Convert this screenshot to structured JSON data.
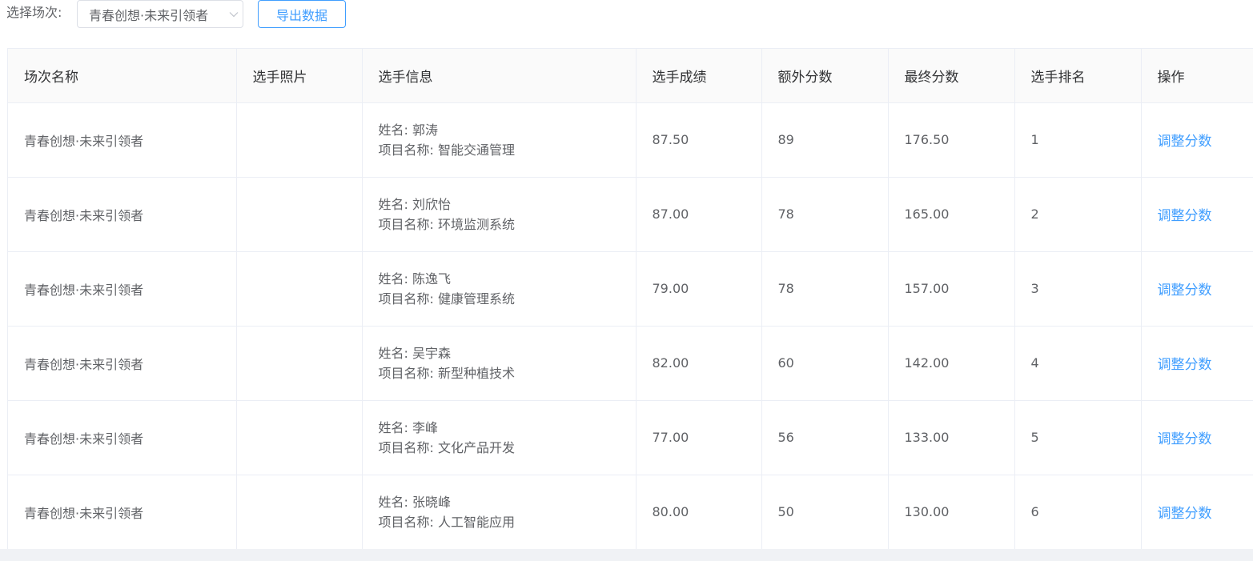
{
  "filter": {
    "label": "选择场次:",
    "selected": "青春创想·未来引领者"
  },
  "export_label": "导出数据",
  "table": {
    "columns": [
      "场次名称",
      "选手照片",
      "选手信息",
      "选手成绩",
      "额外分数",
      "最终分数",
      "选手排名",
      "操作"
    ],
    "rows": [
      {
        "session": "青春创想·未来引领者",
        "name": "姓名: 郭涛",
        "project": "项目名称: 智能交通管理",
        "score": "87.50",
        "extra": "89",
        "final": "176.50",
        "rank": "1",
        "action": "调整分数"
      },
      {
        "session": "青春创想·未来引领者",
        "name": "姓名: 刘欣怡",
        "project": "项目名称: 环境监测系统",
        "score": "87.00",
        "extra": "78",
        "final": "165.00",
        "rank": "2",
        "action": "调整分数"
      },
      {
        "session": "青春创想·未来引领者",
        "name": "姓名: 陈逸飞",
        "project": "项目名称: 健康管理系统",
        "score": "79.00",
        "extra": "78",
        "final": "157.00",
        "rank": "3",
        "action": "调整分数"
      },
      {
        "session": "青春创想·未来引领者",
        "name": "姓名: 吴宇森",
        "project": "项目名称: 新型种植技术",
        "score": "82.00",
        "extra": "60",
        "final": "142.00",
        "rank": "4",
        "action": "调整分数"
      },
      {
        "session": "青春创想·未来引领者",
        "name": "姓名: 李峰",
        "project": "项目名称: 文化产品开发",
        "score": "77.00",
        "extra": "56",
        "final": "133.00",
        "rank": "5",
        "action": "调整分数"
      },
      {
        "session": "青春创想·未来引领者",
        "name": "姓名: 张晓峰",
        "project": "项目名称: 人工智能应用",
        "score": "80.00",
        "extra": "50",
        "final": "130.00",
        "rank": "6",
        "action": "调整分数"
      }
    ]
  },
  "colors": {
    "accent": "#409eff",
    "text": "#606266",
    "header_text": "#303133",
    "border": "#ebeef5",
    "header_bg": "#fafafa"
  },
  "icons": {
    "select_arrow": "chevron-down-icon"
  }
}
